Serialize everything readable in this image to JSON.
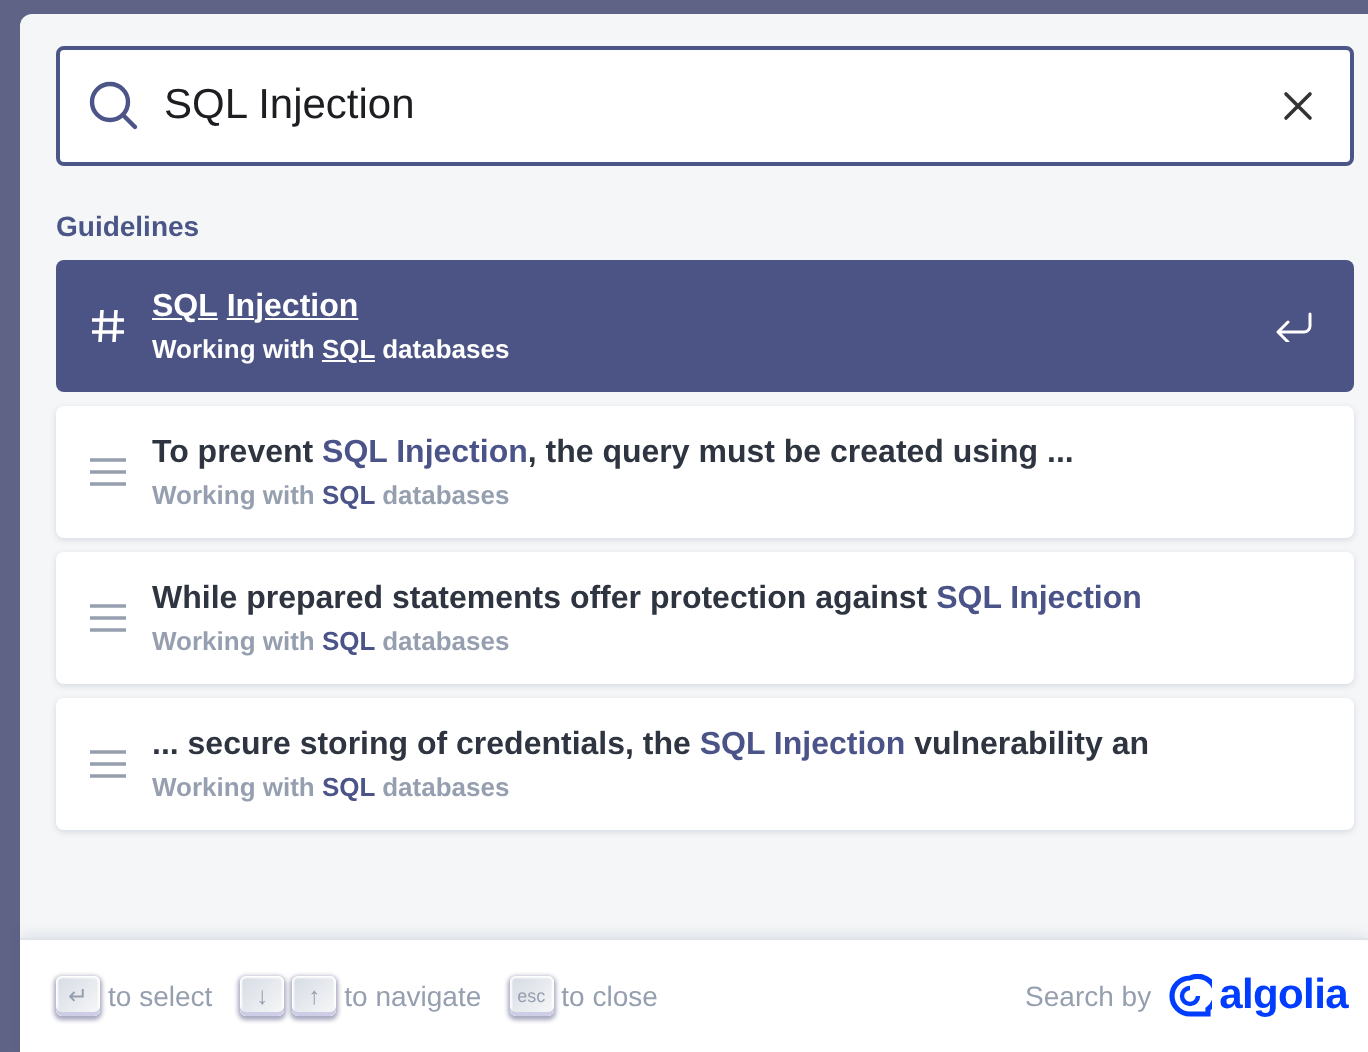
{
  "search": {
    "value": "SQL Injection"
  },
  "section": {
    "title": "Guidelines"
  },
  "hits": [
    {
      "kind": "section",
      "selected": true,
      "title": [
        {
          "text": "SQL",
          "highlight": true
        },
        {
          "text": "Injection",
          "highlight": true,
          "space_before": true
        }
      ],
      "path": [
        {
          "text": "Working with ",
          "highlight": false
        },
        {
          "text": "SQL",
          "highlight": true
        },
        {
          "text": " databases",
          "highlight": false
        }
      ]
    },
    {
      "kind": "text",
      "selected": false,
      "title": [
        {
          "text": "To prevent ",
          "highlight": false
        },
        {
          "text": "SQL Injection",
          "highlight": true
        },
        {
          "text": ", the query must be created using ...",
          "highlight": false
        }
      ],
      "path": [
        {
          "text": "Working with ",
          "highlight": false
        },
        {
          "text": "SQL",
          "highlight": true
        },
        {
          "text": " databases",
          "highlight": false
        }
      ]
    },
    {
      "kind": "text",
      "selected": false,
      "title": [
        {
          "text": "While prepared statements offer protection against ",
          "highlight": false
        },
        {
          "text": "SQL Injection",
          "highlight": true
        }
      ],
      "path": [
        {
          "text": "Working with ",
          "highlight": false
        },
        {
          "text": "SQL",
          "highlight": true
        },
        {
          "text": " databases",
          "highlight": false
        }
      ]
    },
    {
      "kind": "text",
      "selected": false,
      "title": [
        {
          "text": "... secure storing of credentials, the ",
          "highlight": false
        },
        {
          "text": "SQL Injection",
          "highlight": true
        },
        {
          "text": " vulnerability an",
          "highlight": false
        }
      ],
      "path": [
        {
          "text": "Working with ",
          "highlight": false
        },
        {
          "text": "SQL",
          "highlight": true
        },
        {
          "text": " databases",
          "highlight": false
        }
      ]
    }
  ],
  "footer": {
    "commands": [
      {
        "keys": [
          "↵"
        ],
        "label": "to select"
      },
      {
        "keys": [
          "↓",
          "↑"
        ],
        "label": "to navigate"
      },
      {
        "keys": [
          "esc"
        ],
        "label": "to close"
      }
    ],
    "search_by": "Search by",
    "brand": "algolia"
  }
}
